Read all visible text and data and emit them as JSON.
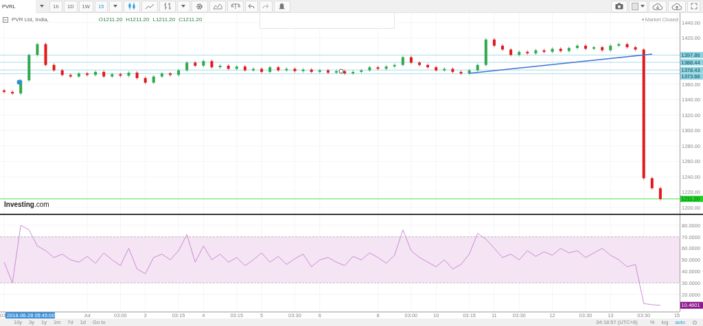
{
  "toolbar": {
    "symbol": "PVRL",
    "intervals": [
      {
        "label": "1h",
        "selected": false
      },
      {
        "label": "1D",
        "selected": false
      },
      {
        "label": "1W",
        "selected": false
      },
      {
        "label": "15",
        "selected": true
      }
    ]
  },
  "legend": {
    "name": "PVR Ltd, India,",
    "ohlc": [
      {
        "key": "O",
        "value": "1211.20"
      },
      {
        "key": "H",
        "value": "1211.20"
      },
      {
        "key": "L",
        "value": "1211.20"
      },
      {
        "key": "C",
        "value": "1211.20"
      }
    ]
  },
  "status": "Market Closed",
  "logo": "**Investing**.com",
  "price_chart": {
    "chart_data": {
      "type": "candlestick",
      "grid": true,
      "ylim": [
        1192,
        1452.4
      ],
      "yticks": [
        {
          "value": 1200,
          "label": "1200.00"
        },
        {
          "value": 1220,
          "label": "1220.00"
        },
        {
          "value": 1240,
          "label": "1240.00"
        },
        {
          "value": 1260,
          "label": "1260.00"
        },
        {
          "value": 1280,
          "label": "1280.00"
        },
        {
          "value": 1300,
          "label": "1300.00"
        },
        {
          "value": 1320,
          "label": "1320.00"
        },
        {
          "value": 1340,
          "label": "1340.00"
        },
        {
          "value": 1360,
          "label": "1360.00"
        },
        {
          "value": 1420,
          "label": "1420.00"
        },
        {
          "value": 1440,
          "label": "1440.00"
        }
      ],
      "ohlc": [
        [
          1352,
          1354,
          1348,
          1350
        ],
        [
          1350,
          1352,
          1346,
          1348
        ],
        [
          1348,
          1367,
          1346,
          1365
        ],
        [
          1365,
          1400,
          1363,
          1398
        ],
        [
          1398,
          1414,
          1396,
          1412
        ],
        [
          1412,
          1414,
          1383,
          1385
        ],
        [
          1385,
          1387,
          1376,
          1378
        ],
        [
          1378,
          1380,
          1370,
          1372
        ],
        [
          1372,
          1374,
          1368,
          1370
        ],
        [
          1370,
          1376,
          1368,
          1374
        ],
        [
          1374,
          1376,
          1370,
          1372
        ],
        [
          1372,
          1378,
          1370,
          1376
        ],
        [
          1376,
          1378,
          1368,
          1370
        ],
        [
          1370,
          1375,
          1368,
          1373
        ],
        [
          1373,
          1375,
          1369,
          1371
        ],
        [
          1371,
          1377,
          1369,
          1375
        ],
        [
          1375,
          1377,
          1366,
          1368
        ],
        [
          1368,
          1370,
          1360,
          1362
        ],
        [
          1362,
          1372,
          1360,
          1370
        ],
        [
          1370,
          1376,
          1368,
          1374
        ],
        [
          1374,
          1376,
          1370,
          1372
        ],
        [
          1372,
          1380,
          1370,
          1378
        ],
        [
          1378,
          1390,
          1376,
          1388
        ],
        [
          1388,
          1390,
          1382,
          1384
        ],
        [
          1384,
          1392,
          1382,
          1390
        ],
        [
          1390,
          1392,
          1380,
          1382
        ],
        [
          1382,
          1386,
          1380,
          1384
        ],
        [
          1384,
          1386,
          1378,
          1380
        ],
        [
          1380,
          1385,
          1378,
          1383
        ],
        [
          1383,
          1385,
          1376,
          1378
        ],
        [
          1378,
          1382,
          1376,
          1380
        ],
        [
          1380,
          1382,
          1374,
          1376
        ],
        [
          1376,
          1384,
          1374,
          1382
        ],
        [
          1382,
          1384,
          1376,
          1378
        ],
        [
          1378,
          1382,
          1376,
          1380
        ],
        [
          1380,
          1382,
          1375,
          1377
        ],
        [
          1377,
          1381,
          1375,
          1379
        ],
        [
          1379,
          1381,
          1374,
          1376
        ],
        [
          1376,
          1380,
          1374,
          1378
        ],
        [
          1378,
          1380,
          1373,
          1375
        ],
        [
          1375,
          1379,
          1373,
          1377
        ],
        [
          1377,
          1379,
          1372,
          1374
        ],
        [
          1374,
          1378,
          1372,
          1376
        ],
        [
          1376,
          1380,
          1374,
          1378
        ],
        [
          1378,
          1384,
          1376,
          1382
        ],
        [
          1382,
          1384,
          1378,
          1380
        ],
        [
          1380,
          1385,
          1378,
          1383
        ],
        [
          1383,
          1387,
          1381,
          1385
        ],
        [
          1385,
          1397,
          1383,
          1395
        ],
        [
          1395,
          1397,
          1386,
          1388
        ],
        [
          1388,
          1390,
          1383,
          1385
        ],
        [
          1385,
          1387,
          1380,
          1382
        ],
        [
          1382,
          1384,
          1376,
          1378
        ],
        [
          1378,
          1382,
          1376,
          1380
        ],
        [
          1380,
          1382,
          1374,
          1376
        ],
        [
          1376,
          1378,
          1372,
          1374
        ],
        [
          1374,
          1380,
          1372,
          1378
        ],
        [
          1378,
          1387,
          1376,
          1385
        ],
        [
          1385,
          1420,
          1383,
          1418
        ],
        [
          1418,
          1420,
          1408,
          1410
        ],
        [
          1410,
          1412,
          1403,
          1405
        ],
        [
          1405,
          1407,
          1396,
          1398
        ],
        [
          1398,
          1404,
          1396,
          1402
        ],
        [
          1402,
          1404,
          1398,
          1400
        ],
        [
          1400,
          1406,
          1398,
          1404
        ],
        [
          1404,
          1406,
          1400,
          1402
        ],
        [
          1402,
          1408,
          1400,
          1406
        ],
        [
          1406,
          1408,
          1401,
          1403
        ],
        [
          1403,
          1409,
          1401,
          1407
        ],
        [
          1407,
          1412,
          1405,
          1410
        ],
        [
          1410,
          1412,
          1404,
          1406
        ],
        [
          1406,
          1410,
          1404,
          1408
        ],
        [
          1408,
          1410,
          1402,
          1404
        ],
        [
          1404,
          1412,
          1402,
          1410
        ],
        [
          1410,
          1414,
          1408,
          1412
        ],
        [
          1412,
          1414,
          1406,
          1408
        ],
        [
          1408,
          1410,
          1403,
          1405
        ],
        [
          1405,
          1407,
          1236,
          1238
        ],
        [
          1238,
          1240,
          1223,
          1225
        ],
        [
          1225,
          1227,
          1209,
          1211
        ]
      ],
      "ref_lines": [
        {
          "axis": "y",
          "value": 1397.86,
          "label": "1397.86",
          "color": "#8fd3e0"
        },
        {
          "axis": "y",
          "value": 1388.44,
          "label": "1388.44",
          "color": "#8fd3e0"
        },
        {
          "axis": "y",
          "value": 1378.43,
          "label": "1378.43",
          "color": "#8fd3e0"
        },
        {
          "axis": "y",
          "value": 1373.66,
          "label": "1373.66",
          "color": "#8fd3e0"
        },
        {
          "axis": "y",
          "value": 1211.2,
          "label": "1211.20",
          "color": "#22d422"
        }
      ]
    }
  },
  "rsi_chart": {
    "chart_data": {
      "type": "line",
      "grid": true,
      "ylim": [
        5,
        88.93
      ],
      "yticks": [
        {
          "value": 20,
          "label": "20.0000"
        },
        {
          "value": 30,
          "label": "30.0000"
        },
        {
          "value": 40,
          "label": "40.0000"
        },
        {
          "value": 50,
          "label": "50.0000"
        },
        {
          "value": 60,
          "label": "60.0000"
        },
        {
          "value": 70,
          "label": "70.0000"
        },
        {
          "value": 80,
          "label": "80.0000"
        }
      ],
      "categories": [
        "03",
        null,
        null,
        null,
        null,
        null,
        null,
        null,
        null,
        null,
        "Jul",
        null,
        null,
        null,
        "03:00",
        null,
        null,
        "3",
        null,
        null,
        null,
        "03:15",
        null,
        null,
        "4",
        null,
        null,
        null,
        "03:15",
        null,
        null,
        "5",
        null,
        null,
        null,
        "03:30",
        null,
        null,
        "6",
        null,
        null,
        null,
        null,
        null,
        null,
        "8",
        null,
        null,
        null,
        "03:00",
        null,
        null,
        "10",
        null,
        null,
        null,
        "03:15",
        null,
        null,
        "11",
        null,
        null,
        "03:30",
        null,
        null,
        null,
        "12",
        null,
        null,
        null,
        "03:30",
        null,
        null,
        "13",
        null,
        null,
        null,
        "03:30",
        null,
        null,
        null,
        "15"
      ],
      "series": [
        {
          "color": "#c77fd0",
          "values": [
            48,
            30,
            80,
            76,
            62,
            58,
            52,
            55,
            50,
            48,
            53,
            47,
            56,
            50,
            45,
            60,
            42,
            38,
            52,
            55,
            50,
            58,
            72,
            48,
            62,
            50,
            55,
            48,
            52,
            45,
            50,
            56,
            48,
            53,
            46,
            51,
            55,
            44,
            50,
            52,
            48,
            45,
            53,
            50,
            56,
            52,
            47,
            54,
            76,
            58,
            52,
            48,
            44,
            50,
            42,
            46,
            55,
            73,
            68,
            60,
            52,
            55,
            50,
            58,
            53,
            57,
            54,
            60,
            56,
            58,
            52,
            56,
            60,
            54,
            50,
            44,
            46,
            12,
            11,
            10.5,
            null,
            null
          ]
        }
      ],
      "bands": [
        {
          "axis": "y",
          "from": 30,
          "to": 70,
          "color": "#f4e4f4"
        }
      ]
    },
    "last_value": "10.4601"
  },
  "time_axis": {
    "cursor": "2018-06-28 05:45:00"
  },
  "bottom_bar": {
    "ranges": [
      "10y",
      "3y",
      "1y",
      "1m",
      "7d",
      "1d",
      "Go to"
    ],
    "clock": "04:18:57 (UTC+8)",
    "options": [
      {
        "label": "%",
        "selected": false
      },
      {
        "label": "log",
        "selected": false
      },
      {
        "label": "auto",
        "selected": true
      }
    ]
  }
}
